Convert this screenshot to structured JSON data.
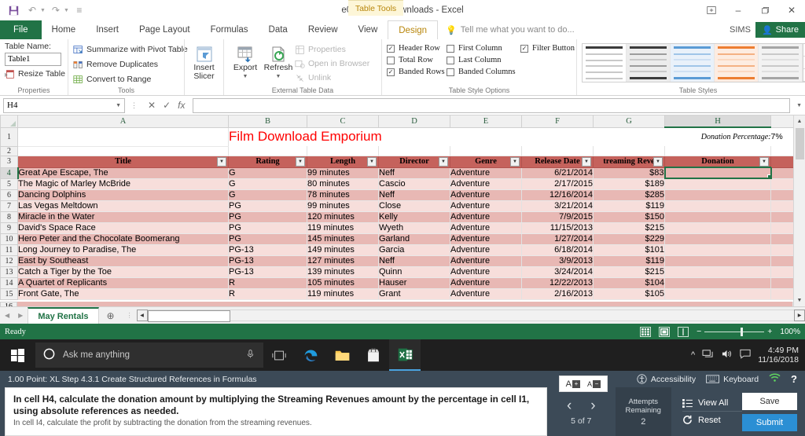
{
  "window": {
    "title": "e04h3Film_Downloads - Excel",
    "table_tools_label": "Table Tools",
    "minimize": "–",
    "restore": "❐",
    "close": "✕",
    "ribbon_display": "⬒"
  },
  "quick_access": {
    "save": "Ὃe",
    "undo": "↶",
    "redo": "↷",
    "customize": "≡"
  },
  "ribbon_tabs": [
    {
      "label": "File",
      "active": false
    },
    {
      "label": "Home",
      "active": false
    },
    {
      "label": "Insert",
      "active": false
    },
    {
      "label": "Page Layout",
      "active": false
    },
    {
      "label": "Formulas",
      "active": false
    },
    {
      "label": "Data",
      "active": false
    },
    {
      "label": "Review",
      "active": false
    },
    {
      "label": "View",
      "active": false
    },
    {
      "label": "Design",
      "active": true
    }
  ],
  "tellme": {
    "placeholder": "Tell me what you want to do...",
    "user": "SIMS",
    "share": "Share"
  },
  "ribbon": {
    "properties": {
      "group_label": "Properties",
      "table_name_label": "Table Name:",
      "table_name_value": "Table1",
      "resize_table": "Resize Table"
    },
    "tools": {
      "group_label": "Tools",
      "items": [
        "Summarize with Pivot Table",
        "Remove Duplicates",
        "Convert to Range"
      ]
    },
    "slicer": {
      "line1": "Insert",
      "line2": "Slicer"
    },
    "external": {
      "group_label": "External Table Data",
      "export": "Export",
      "refresh": "Refresh",
      "properties": "Properties",
      "open_in_browser": "Open in Browser",
      "unlink": "Unlink"
    },
    "style_options": {
      "group_label": "Table Style Options",
      "items": [
        {
          "label": "Header Row",
          "checked": true
        },
        {
          "label": "Total Row",
          "checked": false
        },
        {
          "label": "Banded Rows",
          "checked": true
        },
        {
          "label": "First Column",
          "checked": false
        },
        {
          "label": "Last Column",
          "checked": false
        },
        {
          "label": "Banded Columns",
          "checked": false
        },
        {
          "label": "Filter Button",
          "checked": true
        }
      ]
    },
    "table_styles": {
      "group_label": "Table Styles",
      "thumbs": [
        "#3b3b3b",
        "#4d4d4d",
        "#5b9bd5",
        "#ed7d31",
        "#a5a5a5"
      ],
      "scroll_up": "▲",
      "scroll_down": "▼",
      "more": "☰"
    }
  },
  "formula_bar": {
    "name_box": "H4",
    "cancel": "✕",
    "enter": "✓",
    "insert_function": "fx",
    "formula_value": ""
  },
  "grid": {
    "column_headers": [
      "A",
      "B",
      "C",
      "D",
      "E",
      "F",
      "G",
      "H"
    ],
    "selected_column": "H",
    "selected_cell": "H4",
    "row_numbers": [
      "1",
      "2",
      "3",
      "4",
      "5",
      "6",
      "7",
      "8",
      "9",
      "10",
      "11",
      "12",
      "13",
      "14",
      "15",
      "16"
    ],
    "sheet_title": "Film Download Emporium",
    "donation_percentage_label": "Donation Percentage:",
    "donation_percentage_value": "7%",
    "table_headers": [
      "Title",
      "Rating",
      "Length",
      "Director",
      "Genre",
      "Release Date",
      "treaming Reve",
      "Donation"
    ],
    "rows": [
      {
        "row": "4",
        "title": "Great Ape Escape, The",
        "rating": "G",
        "length": "99 minutes",
        "director": "Neff",
        "genre": "Adventure",
        "release": "6/21/2014",
        "revenue": "$83",
        "donation": ""
      },
      {
        "row": "5",
        "title": "The Magic of Marley McBride",
        "rating": "G",
        "length": "80 minutes",
        "director": "Cascio",
        "genre": "Adventure",
        "release": "2/17/2015",
        "revenue": "$189",
        "donation": ""
      },
      {
        "row": "6",
        "title": "Dancing Dolphins",
        "rating": "G",
        "length": "78 minutes",
        "director": "Neff",
        "genre": "Adventure",
        "release": "12/16/2014",
        "revenue": "$285",
        "donation": ""
      },
      {
        "row": "7",
        "title": "Las Vegas Meltdown",
        "rating": "PG",
        "length": "99 minutes",
        "director": "Close",
        "genre": "Adventure",
        "release": "3/21/2014",
        "revenue": "$119",
        "donation": ""
      },
      {
        "row": "8",
        "title": "Miracle in the Water",
        "rating": "PG",
        "length": "120 minutes",
        "director": "Kelly",
        "genre": "Adventure",
        "release": "7/9/2015",
        "revenue": "$150",
        "donation": ""
      },
      {
        "row": "9",
        "title": "David's Space Race",
        "rating": "PG",
        "length": "119 minutes",
        "director": "Wyeth",
        "genre": "Adventure",
        "release": "11/15/2013",
        "revenue": "$215",
        "donation": ""
      },
      {
        "row": "10",
        "title": "Hero Peter and the Chocolate Boomerang",
        "rating": "PG",
        "length": "145 minutes",
        "director": "Garland",
        "genre": "Adventure",
        "release": "1/27/2014",
        "revenue": "$229",
        "donation": ""
      },
      {
        "row": "11",
        "title": "Long Journey to Paradise, The",
        "rating": "PG-13",
        "length": "149 minutes",
        "director": "Garcia",
        "genre": "Adventure",
        "release": "6/18/2014",
        "revenue": "$101",
        "donation": ""
      },
      {
        "row": "12",
        "title": "East by Southeast",
        "rating": "PG-13",
        "length": "127 minutes",
        "director": "Neff",
        "genre": "Adventure",
        "release": "3/9/2013",
        "revenue": "$119",
        "donation": ""
      },
      {
        "row": "13",
        "title": "Catch a Tiger by the Toe",
        "rating": "PG-13",
        "length": "139 minutes",
        "director": "Quinn",
        "genre": "Adventure",
        "release": "3/24/2014",
        "revenue": "$215",
        "donation": ""
      },
      {
        "row": "14",
        "title": "A Quartet of Replicants",
        "rating": "R",
        "length": "105 minutes",
        "director": "Hauser",
        "genre": "Adventure",
        "release": "12/22/2013",
        "revenue": "$104",
        "donation": ""
      },
      {
        "row": "15",
        "title": "Front Gate, The",
        "rating": "R",
        "length": "119 minutes",
        "director": "Grant",
        "genre": "Adventure",
        "release": "2/16/2013",
        "revenue": "$105",
        "donation": ""
      }
    ]
  },
  "sheet_tabs": {
    "tabs": [
      "May Rentals"
    ],
    "add": "⊕",
    "prev": "◀",
    "next": "▶"
  },
  "status_bar": {
    "status": "Ready",
    "zoom": "100%",
    "zoom_minus": "−",
    "zoom_plus": "+",
    "views": [
      "normal-view",
      "page-layout-view",
      "page-break-view"
    ]
  },
  "taskbar": {
    "search_placeholder": "Ask me anything",
    "time": "4:49 PM",
    "date": "11/16/2018"
  },
  "sim_panel": {
    "header": "1.00 Point: XL Step 4.3.1 Create Structured References in Formulas",
    "accessibility": "Accessibility",
    "keyboard": "Keyboard",
    "help": "?",
    "font_bigger": "A",
    "font_smaller": "A",
    "instruction_main": "In cell H4, calculate the donation amount by multiplying the Streaming Revenues amount by the percentage in cell I1, using absolute references as needed.",
    "instruction_sub": "In cell I4, calculate the profit by subtracting the donation from the streaming revenues.",
    "prev_arrow": "‹",
    "next_arrow": "›",
    "progress": "5 of 7",
    "attempts_label_1": "Attempts",
    "attempts_label_2": "Remaining",
    "attempts_value": "2",
    "view_all": "View All",
    "reset": "Reset",
    "save": "Save",
    "submit": "Submit"
  }
}
